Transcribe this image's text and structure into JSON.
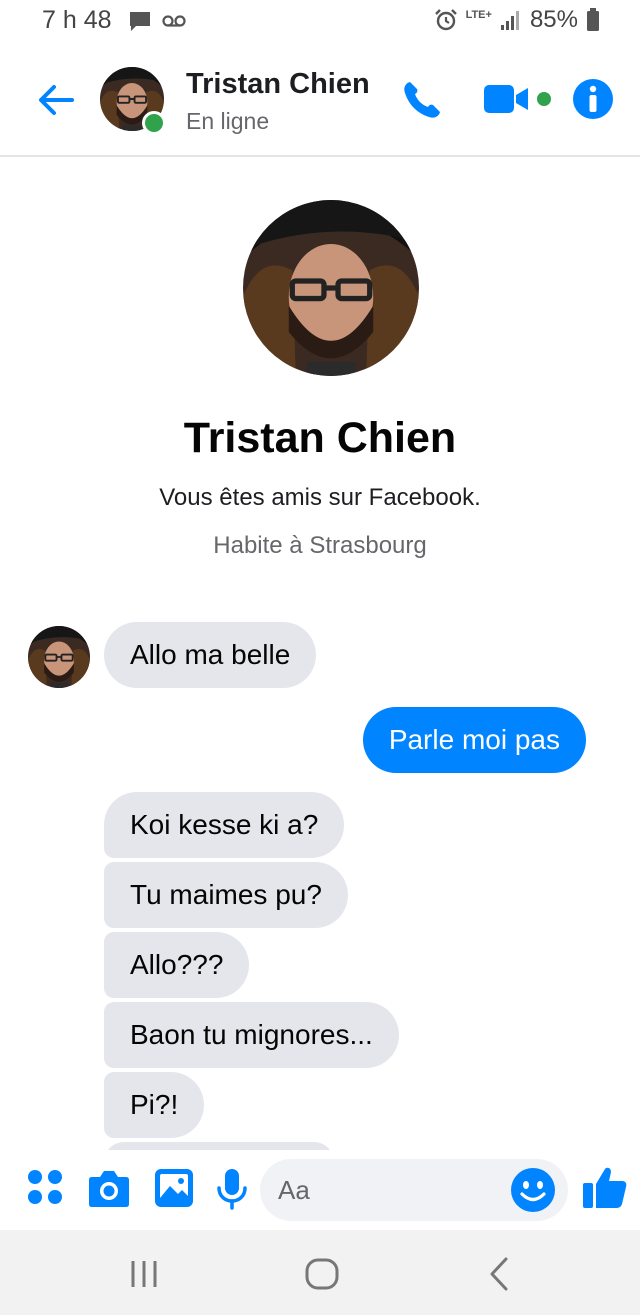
{
  "status_bar": {
    "time": "7 h 48",
    "network": "LTE+",
    "battery": "85%"
  },
  "header": {
    "name": "Tristan Chien",
    "status": "En ligne"
  },
  "profile": {
    "name": "Tristan Chien",
    "friends_text": "Vous êtes amis sur Facebook.",
    "location": "Habite à Strasbourg"
  },
  "messages": [
    {
      "from": "them",
      "text": "Allo ma belle"
    },
    {
      "from": "me",
      "text": "Parle moi pas"
    },
    {
      "from": "them",
      "text": "Koi kesse ki a?"
    },
    {
      "from": "them",
      "text": "Tu maimes pu?"
    },
    {
      "from": "them",
      "text": "Allo???"
    },
    {
      "from": "them",
      "text": "Baon tu mignores..."
    },
    {
      "from": "them",
      "text": "Pi?!"
    }
  ],
  "composer": {
    "placeholder": "Aa"
  },
  "colors": {
    "accent": "#0084ff",
    "incoming_bubble": "#e4e6eb",
    "online": "#31a24c"
  },
  "icons": {
    "header": [
      "back-arrow-icon",
      "phone-icon",
      "video-camera-icon",
      "info-icon"
    ],
    "composer": [
      "apps-icon",
      "camera-icon",
      "gallery-icon",
      "microphone-icon",
      "emoji-icon",
      "thumbs-up-icon"
    ],
    "nav": [
      "recents-icon",
      "home-icon",
      "back-icon"
    ]
  }
}
